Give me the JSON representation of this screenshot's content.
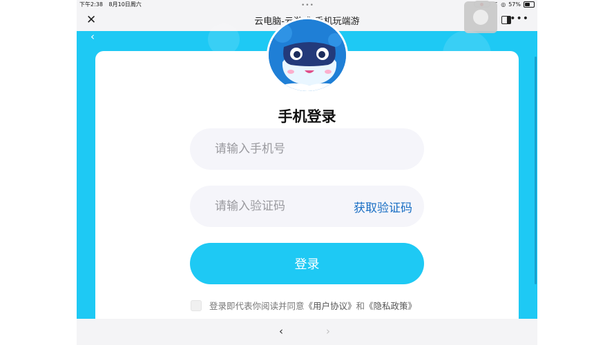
{
  "status_bar": {
    "time": "下午2:38",
    "date": "8月10日周六",
    "battery_text": "57%",
    "battery_level": 0.57
  },
  "browser": {
    "title": "云电脑-云游戏-手机玩端游",
    "close_icon": "close-icon",
    "more_icon": "more-icon"
  },
  "login": {
    "title": "手机登录",
    "phone_placeholder": "请输入手机号",
    "code_placeholder": "请输入验证码",
    "get_code_label": "获取验证码",
    "submit_label": "登录",
    "agreement_prefix": "登录即代表你阅读并同意",
    "user_agreement": "《用户协议》",
    "and_text": "和",
    "privacy_policy": "《隐私政策》"
  },
  "colors": {
    "brand": "#1ec9f4",
    "link": "#1a6fc4"
  }
}
